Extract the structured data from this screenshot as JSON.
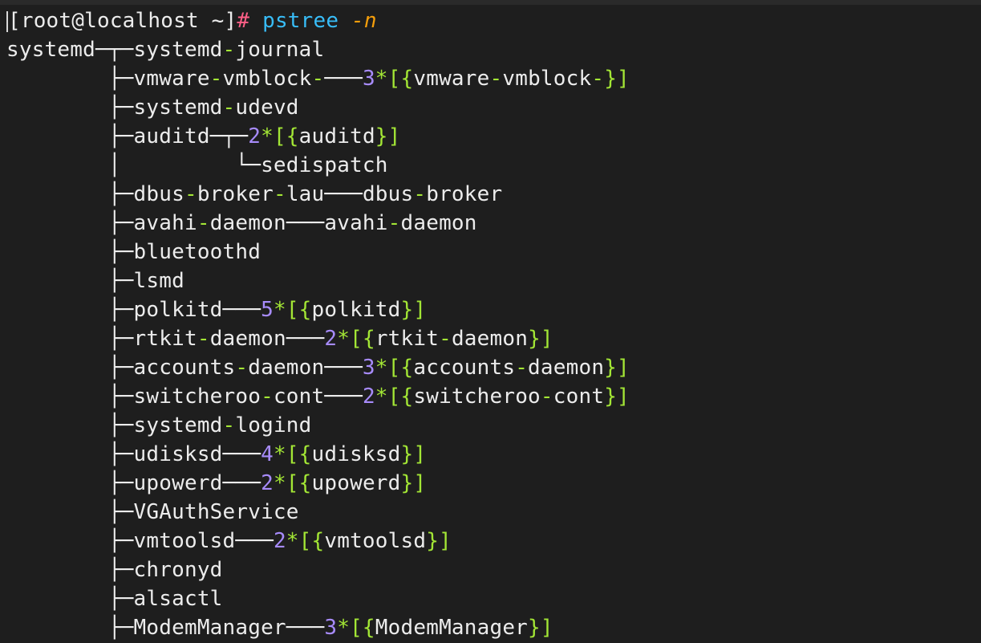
{
  "terminal": {
    "prompt_user_host": "[root@localhost ~]",
    "prompt_hash": "#",
    "command": "pstree",
    "flag": "-n"
  },
  "tree": [
    {
      "prefix": "systemd─┬─",
      "parts": [
        [
          "n",
          "systemd"
        ],
        [
          "s",
          "-"
        ],
        [
          "n",
          "journal"
        ]
      ]
    },
    {
      "prefix": "        ├─",
      "parts": [
        [
          "n",
          "vmware"
        ],
        [
          "s",
          "-"
        ],
        [
          "n",
          "vmblock"
        ],
        [
          "s",
          "-"
        ],
        [
          "t",
          "───"
        ],
        [
          "x",
          "3"
        ],
        [
          "s",
          "*"
        ],
        [
          "b",
          "[{"
        ],
        [
          "n",
          "vmware"
        ],
        [
          "s",
          "-"
        ],
        [
          "n",
          "vmblock"
        ],
        [
          "s",
          "-"
        ],
        [
          "b",
          "}]"
        ]
      ]
    },
    {
      "prefix": "        ├─",
      "parts": [
        [
          "n",
          "systemd"
        ],
        [
          "s",
          "-"
        ],
        [
          "n",
          "udevd"
        ]
      ]
    },
    {
      "prefix": "        ├─",
      "parts": [
        [
          "n",
          "auditd"
        ],
        [
          "t",
          "─┬─"
        ],
        [
          "x",
          "2"
        ],
        [
          "s",
          "*"
        ],
        [
          "b",
          "[{"
        ],
        [
          "n",
          "auditd"
        ],
        [
          "b",
          "}]"
        ]
      ]
    },
    {
      "prefix": "        │",
      "parts": [
        [
          "t",
          "         └─"
        ],
        [
          "n",
          "sedispatch"
        ]
      ]
    },
    {
      "prefix": "        ├─",
      "parts": [
        [
          "n",
          "dbus"
        ],
        [
          "s",
          "-"
        ],
        [
          "n",
          "broker"
        ],
        [
          "s",
          "-"
        ],
        [
          "n",
          "lau"
        ],
        [
          "t",
          "───"
        ],
        [
          "n",
          "dbus"
        ],
        [
          "s",
          "-"
        ],
        [
          "n",
          "broker"
        ]
      ]
    },
    {
      "prefix": "        ├─",
      "parts": [
        [
          "n",
          "avahi"
        ],
        [
          "s",
          "-"
        ],
        [
          "n",
          "daemon"
        ],
        [
          "t",
          "───"
        ],
        [
          "n",
          "avahi"
        ],
        [
          "s",
          "-"
        ],
        [
          "n",
          "daemon"
        ]
      ]
    },
    {
      "prefix": "        ├─",
      "parts": [
        [
          "n",
          "bluetoothd"
        ]
      ]
    },
    {
      "prefix": "        ├─",
      "parts": [
        [
          "n",
          "lsmd"
        ]
      ]
    },
    {
      "prefix": "        ├─",
      "parts": [
        [
          "n",
          "polkitd"
        ],
        [
          "t",
          "───"
        ],
        [
          "x",
          "5"
        ],
        [
          "s",
          "*"
        ],
        [
          "b",
          "[{"
        ],
        [
          "n",
          "polkitd"
        ],
        [
          "b",
          "}]"
        ]
      ]
    },
    {
      "prefix": "        ├─",
      "parts": [
        [
          "n",
          "rtkit"
        ],
        [
          "s",
          "-"
        ],
        [
          "n",
          "daemon"
        ],
        [
          "t",
          "───"
        ],
        [
          "x",
          "2"
        ],
        [
          "s",
          "*"
        ],
        [
          "b",
          "[{"
        ],
        [
          "n",
          "rtkit"
        ],
        [
          "s",
          "-"
        ],
        [
          "n",
          "daemon"
        ],
        [
          "b",
          "}]"
        ]
      ]
    },
    {
      "prefix": "        ├─",
      "parts": [
        [
          "n",
          "accounts"
        ],
        [
          "s",
          "-"
        ],
        [
          "n",
          "daemon"
        ],
        [
          "t",
          "───"
        ],
        [
          "x",
          "3"
        ],
        [
          "s",
          "*"
        ],
        [
          "b",
          "[{"
        ],
        [
          "n",
          "accounts"
        ],
        [
          "s",
          "-"
        ],
        [
          "n",
          "daemon"
        ],
        [
          "b",
          "}]"
        ]
      ]
    },
    {
      "prefix": "        ├─",
      "parts": [
        [
          "n",
          "switcheroo"
        ],
        [
          "s",
          "-"
        ],
        [
          "n",
          "cont"
        ],
        [
          "t",
          "───"
        ],
        [
          "x",
          "2"
        ],
        [
          "s",
          "*"
        ],
        [
          "b",
          "[{"
        ],
        [
          "n",
          "switcheroo"
        ],
        [
          "s",
          "-"
        ],
        [
          "n",
          "cont"
        ],
        [
          "b",
          "}]"
        ]
      ]
    },
    {
      "prefix": "        ├─",
      "parts": [
        [
          "n",
          "systemd"
        ],
        [
          "s",
          "-"
        ],
        [
          "n",
          "logind"
        ]
      ]
    },
    {
      "prefix": "        ├─",
      "parts": [
        [
          "n",
          "udisksd"
        ],
        [
          "t",
          "───"
        ],
        [
          "x",
          "4"
        ],
        [
          "s",
          "*"
        ],
        [
          "b",
          "[{"
        ],
        [
          "n",
          "udisksd"
        ],
        [
          "b",
          "}]"
        ]
      ]
    },
    {
      "prefix": "        ├─",
      "parts": [
        [
          "n",
          "upowerd"
        ],
        [
          "t",
          "───"
        ],
        [
          "x",
          "2"
        ],
        [
          "s",
          "*"
        ],
        [
          "b",
          "[{"
        ],
        [
          "n",
          "upowerd"
        ],
        [
          "b",
          "}]"
        ]
      ]
    },
    {
      "prefix": "        ├─",
      "parts": [
        [
          "n",
          "VGAuthService"
        ]
      ]
    },
    {
      "prefix": "        ├─",
      "parts": [
        [
          "n",
          "vmtoolsd"
        ],
        [
          "t",
          "───"
        ],
        [
          "x",
          "2"
        ],
        [
          "s",
          "*"
        ],
        [
          "b",
          "[{"
        ],
        [
          "n",
          "vmtoolsd"
        ],
        [
          "b",
          "}]"
        ]
      ]
    },
    {
      "prefix": "        ├─",
      "parts": [
        [
          "n",
          "chronyd"
        ]
      ]
    },
    {
      "prefix": "        ├─",
      "parts": [
        [
          "n",
          "alsactl"
        ]
      ]
    },
    {
      "prefix": "        ├─",
      "parts": [
        [
          "n",
          "ModemManager"
        ],
        [
          "t",
          "───"
        ],
        [
          "x",
          "3"
        ],
        [
          "s",
          "*"
        ],
        [
          "b",
          "[{"
        ],
        [
          "n",
          "ModemManager"
        ],
        [
          "b",
          "}]"
        ]
      ]
    }
  ],
  "colors": {
    "background": "#1e1e1e",
    "text": "#ececec",
    "hash": "#ff5f87",
    "command": "#38bdf8",
    "flag": "#f59e0b",
    "separator": "#a3e635",
    "count": "#a78bfa"
  }
}
